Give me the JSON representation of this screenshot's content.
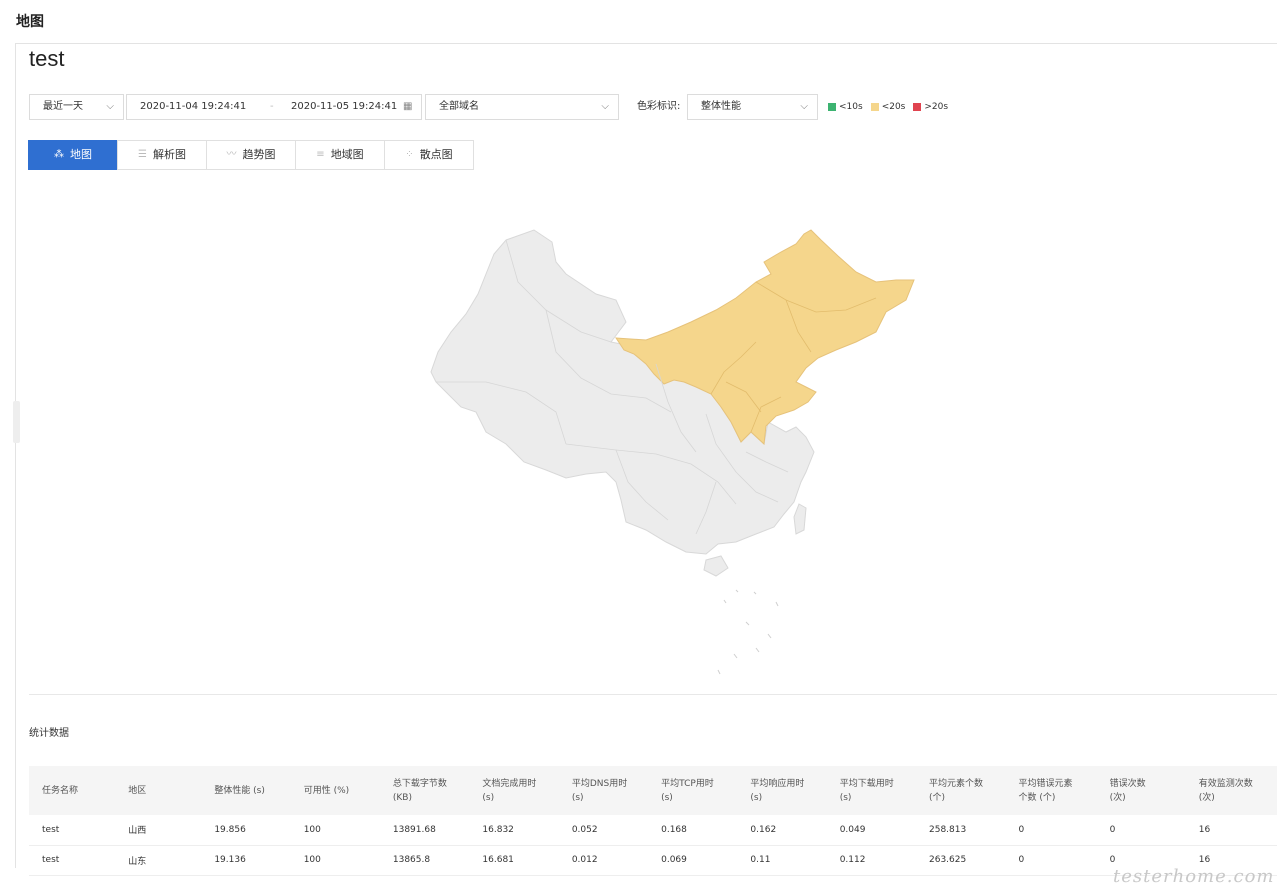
{
  "page_heading": "地图",
  "panel_title": "test",
  "filters": {
    "time_range": "最近一天",
    "start": "2020-11-04 19:24:41",
    "separator": "-",
    "end": "2020-11-05 19:24:41",
    "domain": "全部域名",
    "color_label": "色彩标识:",
    "color_metric": "整体性能",
    "legend": [
      {
        "label": "<10s",
        "color": "#3cb371"
      },
      {
        "label": "<20s",
        "color": "#f5d68c"
      },
      {
        "label": ">20s",
        "color": "#e0434f"
      }
    ]
  },
  "tabs": [
    {
      "label": "地图",
      "icon": "grid-map-icon",
      "active": true
    },
    {
      "label": "解析图",
      "icon": "bar-chart-icon",
      "active": false
    },
    {
      "label": "趋势图",
      "icon": "trend-line-icon",
      "active": false
    },
    {
      "label": "地域图",
      "icon": "region-bar-icon",
      "active": false
    },
    {
      "label": "散点图",
      "icon": "scatter-icon",
      "active": false
    }
  ],
  "map": {
    "highlight_color": "#f5d68c",
    "base_color": "#ececec",
    "highlighted_regions": [
      "Heilongjiang",
      "Jilin",
      "Liaoning",
      "Inner Mongolia",
      "Hebei",
      "Beijing",
      "Tianjin",
      "Shanxi",
      "Shandong"
    ]
  },
  "stats": {
    "title": "统计数据",
    "columns": [
      "任务名称",
      "地区",
      "整体性能 (s)",
      "可用性 (%)",
      "总下载字节数\n(KB)",
      "文档完成用时\n(s)",
      "平均DNS用时\n(s)",
      "平均TCP用时\n(s)",
      "平均响应用时\n(s)",
      "平均下载用时\n(s)",
      "平均元素个数\n(个)",
      "平均错误元素\n个数 (个)",
      "错误次数\n(次)",
      "有效监测次数\n(次)"
    ],
    "rows": [
      [
        "test",
        "山西",
        "19.856",
        "100",
        "13891.68",
        "16.832",
        "0.052",
        "0.168",
        "0.162",
        "0.049",
        "258.813",
        "0",
        "0",
        "16"
      ],
      [
        "test",
        "山东",
        "19.136",
        "100",
        "13865.8",
        "16.681",
        "0.012",
        "0.069",
        "0.11",
        "0.112",
        "263.625",
        "0",
        "0",
        "16"
      ]
    ]
  },
  "watermark": "testerhome.com"
}
